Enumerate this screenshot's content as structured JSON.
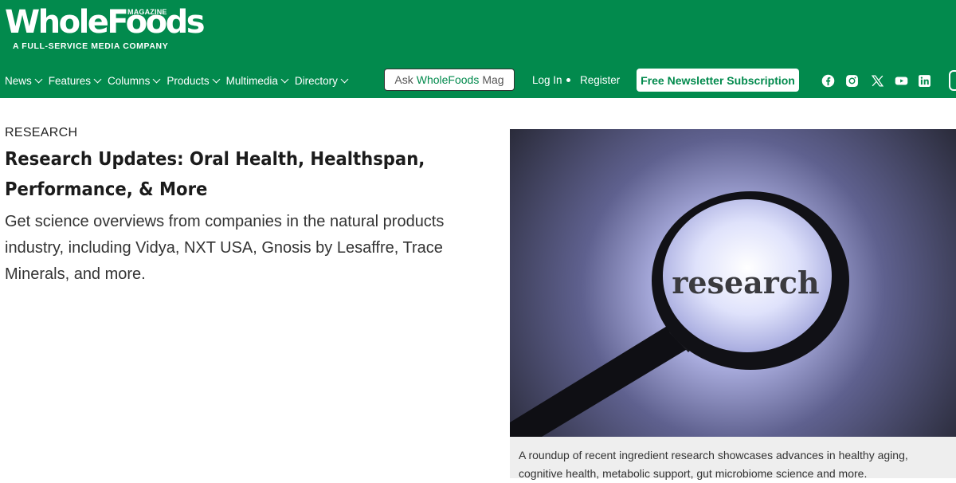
{
  "header": {
    "logo_main": "WholeFoods",
    "logo_magazine": "MAGAZINE",
    "tagline": "A FULL-SERVICE MEDIA COMPANY",
    "bg_color": "#028a4d"
  },
  "nav": {
    "items": [
      "News",
      "Features",
      "Columns",
      "Products",
      "Multimedia",
      "Directory"
    ]
  },
  "ask": {
    "prefix": "Ask",
    "brand": "WholeFoods",
    "suffix": "Mag"
  },
  "account": {
    "login": "Log In",
    "register": "Register"
  },
  "newsletter": {
    "label": "Free Newsletter Subscription"
  },
  "social": [
    "facebook-icon",
    "instagram-icon",
    "x-icon",
    "youtube-icon",
    "linkedin-icon"
  ],
  "article": {
    "category": "RESEARCH",
    "title": "Research Updates: Oral Health, Healthspan, Performance, & More",
    "summary": "Get science overviews from companies in the natural products industry, including Vidya, NXT USA, Gnosis by Lesaffre, Trace Minerals, and more."
  },
  "hero": {
    "lens_text": "research",
    "caption": "A roundup of recent ingredient research showcases advances in healthy aging, cognitive health, metabolic support, gut microbiome science and more."
  }
}
